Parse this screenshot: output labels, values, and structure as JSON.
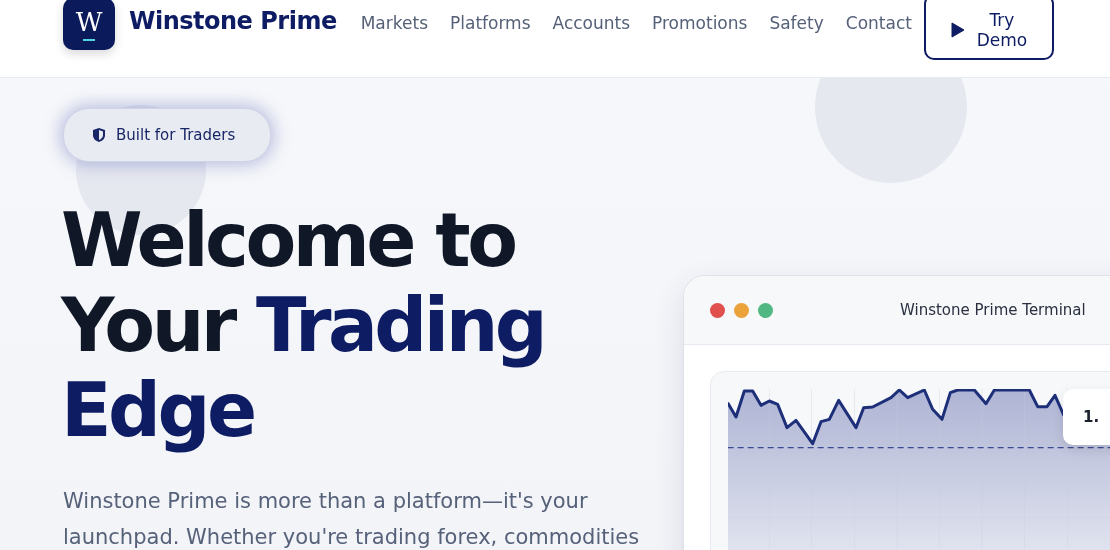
{
  "brand": {
    "logo_letter": "W",
    "name": "Winstone Prime"
  },
  "nav": [
    "Markets",
    "Platforms",
    "Accounts",
    "Promotions",
    "Safety",
    "Contact"
  ],
  "cta": {
    "label_line_1": "Try",
    "label_line_2": "Demo"
  },
  "badge": "Built for Traders",
  "heading": {
    "line_1": "Welcome to",
    "line_2_plain": "Your",
    "line_2_accent": "Trading",
    "line_3_accent": "Edge"
  },
  "intro": [
    "Winstone Prime is more than a platform—it's your",
    "launchpad. Whether you're trading forex, commodities"
  ],
  "terminal": {
    "title": "Winstone Prime Terminal",
    "dots": [
      {
        "color": "#e0504d"
      },
      {
        "color": "#eca23a"
      },
      {
        "color": "#52b883"
      }
    ],
    "price_tag": "1."
  }
}
